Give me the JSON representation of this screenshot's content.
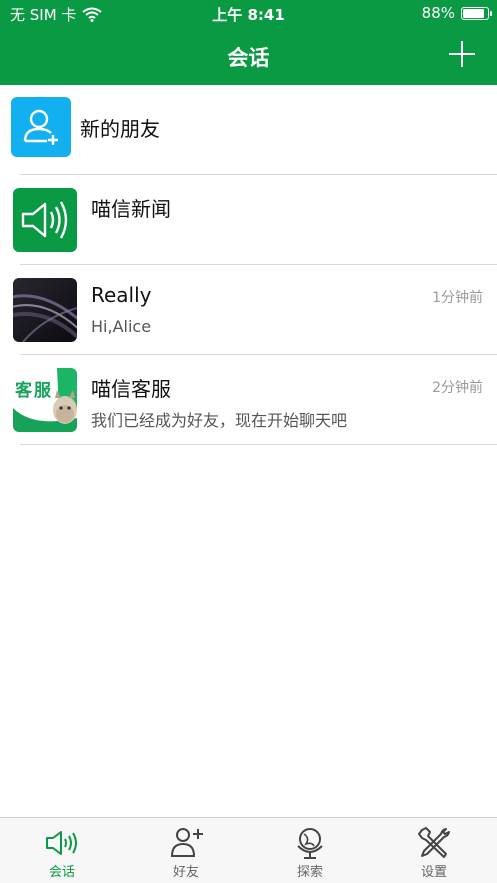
{
  "status_bar": {
    "carrier": "无 SIM 卡",
    "time": "上午 8:41",
    "battery": "88%",
    "battery_level": 0.88
  },
  "header": {
    "title": "会话"
  },
  "new_friends": {
    "label": "新的朋友"
  },
  "conversations": [
    {
      "name": "喵信新闻",
      "preview": "",
      "time": ""
    },
    {
      "name": "Really",
      "preview": "Hi,Alice",
      "time": "1分钟前"
    },
    {
      "name": "喵信客服",
      "preview": "我们已经成为好友，现在开始聊天吧",
      "time": "2分钟前",
      "avatar_text": "客服"
    }
  ],
  "tabs": [
    {
      "label": "会话",
      "icon": "speaker-icon",
      "active": true
    },
    {
      "label": "好友",
      "icon": "add-friend-icon"
    },
    {
      "label": "探索",
      "icon": "globe-icon"
    },
    {
      "label": "设置",
      "icon": "tools-icon"
    }
  ],
  "colors": {
    "brand": "#0b9a44",
    "new_friends_icon_bg": "#12b0f0",
    "news_icon_bg": "#0b9a44"
  }
}
